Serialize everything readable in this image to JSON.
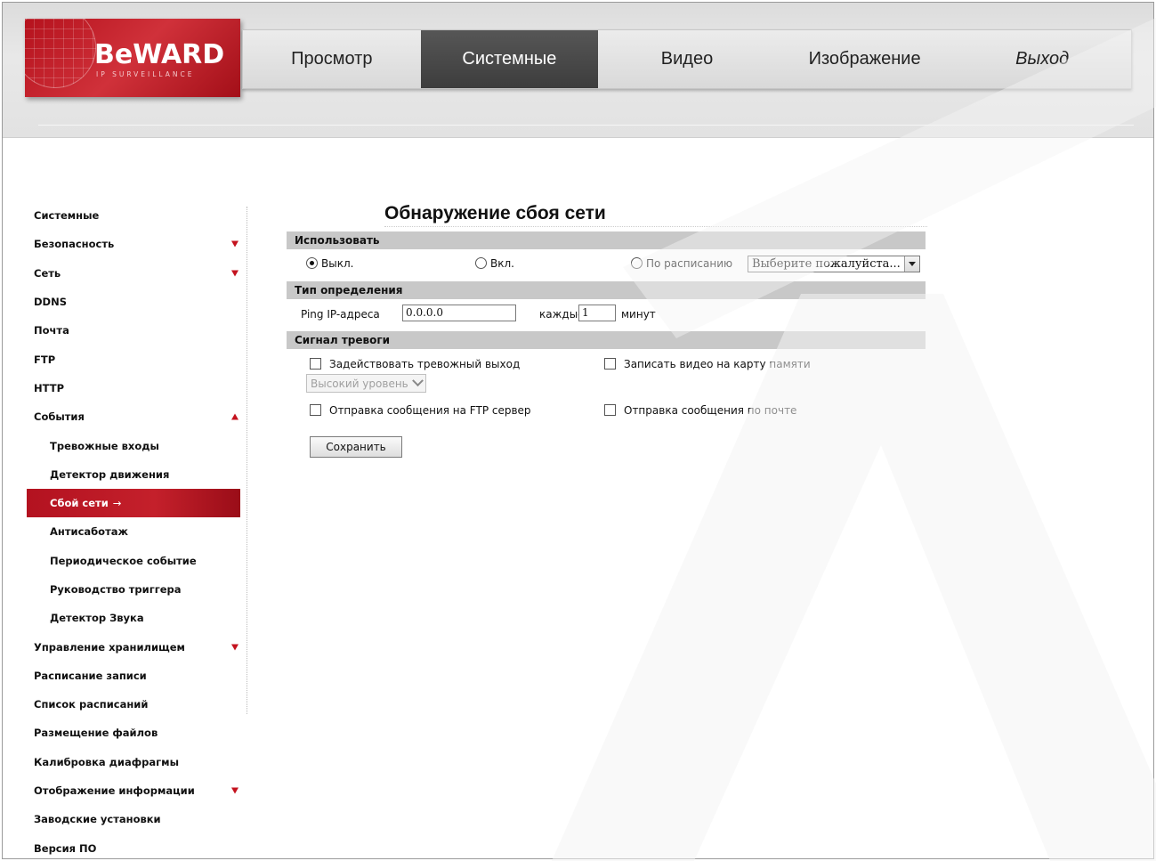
{
  "logo": {
    "text": "BeWARD",
    "subtitle": "IP SURVEILLANCE"
  },
  "nav": {
    "items": [
      {
        "label": "Просмотр"
      },
      {
        "label": "Системные"
      },
      {
        "label": "Видео"
      },
      {
        "label": "Изображение"
      },
      {
        "label": "Выход"
      }
    ],
    "active": "Системные"
  },
  "sidebar": {
    "items": [
      {
        "label": "Системные"
      },
      {
        "label": "Безопасность",
        "arrow": "down"
      },
      {
        "label": "Сеть",
        "arrow": "down"
      },
      {
        "label": "DDNS"
      },
      {
        "label": "Почта"
      },
      {
        "label": "FTP"
      },
      {
        "label": "HTTP"
      },
      {
        "label": "События",
        "arrow": "up"
      },
      {
        "label": "Тревожные входы",
        "sub": true
      },
      {
        "label": "Детектор движения",
        "sub": true
      },
      {
        "label": "Сбой сети",
        "sub": true,
        "active": true
      },
      {
        "label": "Антисаботаж",
        "sub": true
      },
      {
        "label": "Периодическое событие",
        "sub": true
      },
      {
        "label": "Руководство триггера",
        "sub": true
      },
      {
        "label": "Детектор Звука",
        "sub": true
      },
      {
        "label": "Управление хранилищем",
        "arrow": "down"
      },
      {
        "label": "Расписание записи"
      },
      {
        "label": "Список расписаний"
      },
      {
        "label": "Размещение файлов"
      },
      {
        "label": "Калибровка диафрагмы"
      },
      {
        "label": "Отображение информации",
        "arrow": "down"
      },
      {
        "label": "Заводские установки"
      },
      {
        "label": "Версия ПО"
      }
    ],
    "active_arrow": "→"
  },
  "main": {
    "title": "Обнаружение сбоя сети",
    "use_section": {
      "header": "Использовать",
      "off_label": "Выкл.",
      "on_label": "Вкл.",
      "schedule_label": "По расписанию",
      "schedule_select_value": "Выберите пожалуйста...",
      "selected": "off"
    },
    "detect_section": {
      "header": "Тип определения",
      "ping_label": "Ping IP-адреса",
      "ip_value": "0.0.0.0",
      "every_label": "каждые",
      "interval_value": "1",
      "unit_label": "минут"
    },
    "alarm_section": {
      "header": "Сигнал тревоги",
      "alarm_output_label": "Задействовать тревожный выход",
      "level_select_value": "Высокий уровень",
      "record_sd_label": "Записать видео на карту памяти",
      "ftp_label": "Отправка сообщения на FTP сервер",
      "mail_label": "Отправка сообщения по почте"
    },
    "save_label": "Сохранить"
  },
  "colors": {
    "brand_red": "#c4121e",
    "nav_active": "#4a4a4a",
    "section_bg": "#c8c8c8"
  }
}
